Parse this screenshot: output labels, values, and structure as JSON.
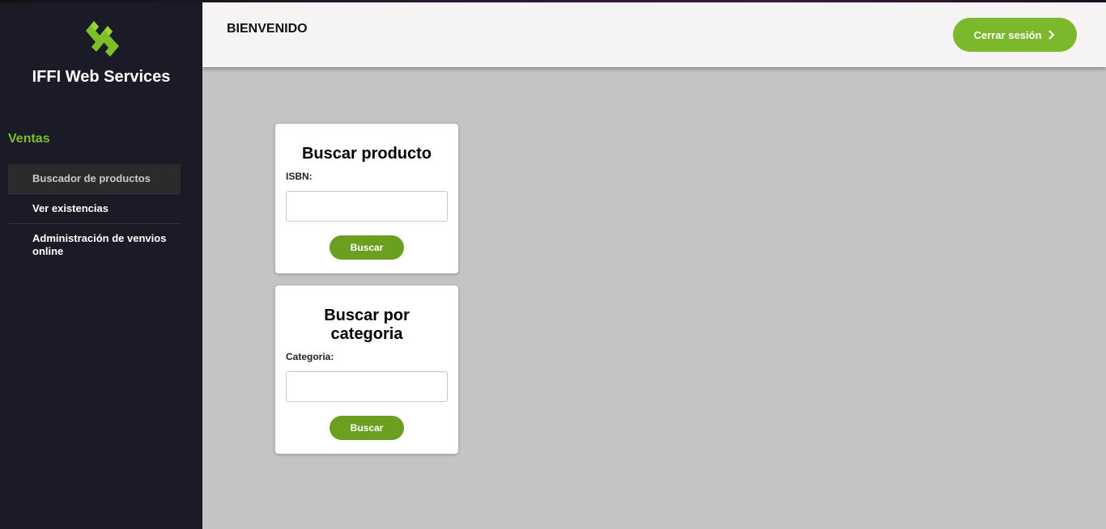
{
  "sidebar": {
    "brand": "IFFI Web Services",
    "logo_icon": "double-chevron-logo-icon",
    "section_title": "Ventas",
    "items": [
      {
        "label": "Buscador de productos",
        "active": true
      },
      {
        "label": "Ver existencias",
        "active": false
      },
      {
        "label": "Administración de venvios online",
        "active": false
      }
    ]
  },
  "header": {
    "welcome": "BIENVENIDO",
    "logout_label": "Cerrar sesión",
    "logout_icon": "chevron-right-icon"
  },
  "cards": [
    {
      "title": "Buscar producto",
      "field_label": "ISBN:",
      "field_value": "",
      "button_label": "Buscar"
    },
    {
      "title": "Buscar por categoria",
      "field_label": "Categoria:",
      "field_value": "",
      "button_label": "Buscar"
    }
  ],
  "colors": {
    "accent": "#7cb82c",
    "sidebar_bg": "#1b1b27",
    "content_bg": "#c4c4c4",
    "section_title": "#7cbf26"
  }
}
